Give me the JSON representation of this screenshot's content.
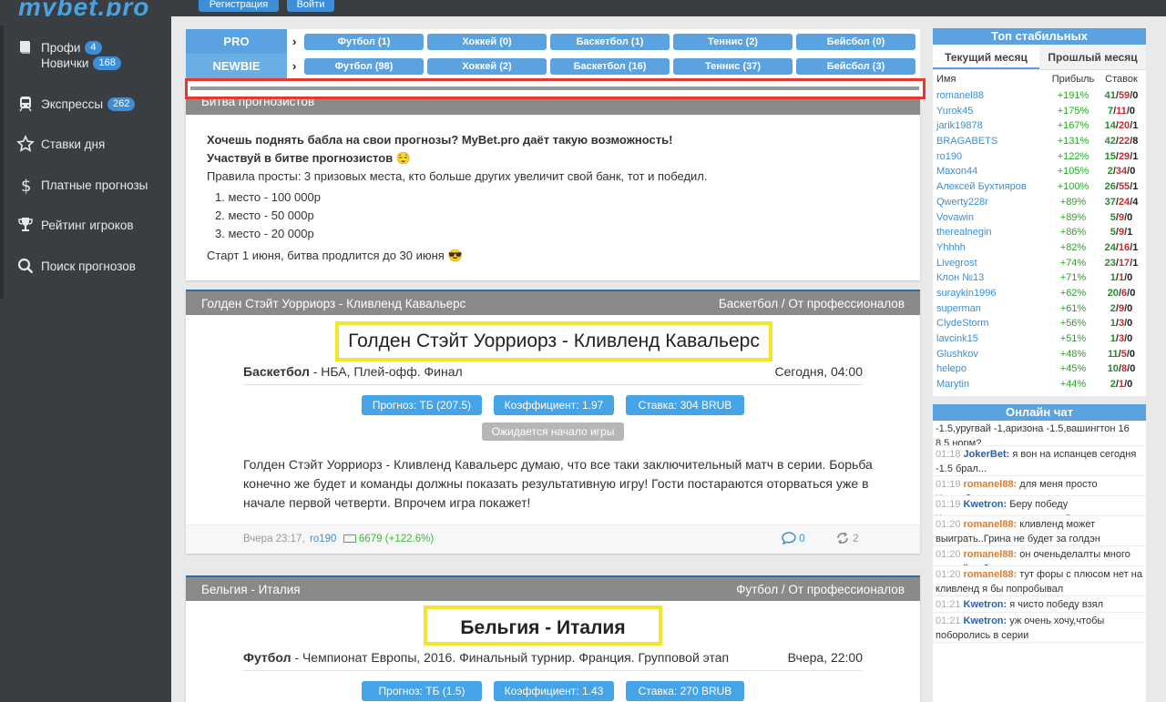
{
  "header": {
    "logo": "mybet.pro",
    "register_label": "Регистрация",
    "login_label": "Войти"
  },
  "sidebar": {
    "profi": {
      "label": "Профи",
      "count": "4"
    },
    "novice": {
      "label": "Новички",
      "count": "168"
    },
    "express": {
      "label": "Экспрессы",
      "count": "262"
    },
    "bets_day": "Ставки дня",
    "paid": "Платные прогнозы",
    "rating": "Рейтинг игроков",
    "search": "Поиск прогнозов"
  },
  "categories": {
    "pro": {
      "label": "PRO",
      "items": [
        "Футбол (1)",
        "Хоккей (0)",
        "Баскетбол (1)",
        "Теннис (2)",
        "Бейсбол (0)"
      ]
    },
    "newbie": {
      "label": "NEWBIE",
      "items": [
        "Футбол (98)",
        "Хоккей (2)",
        "Баскетбол (16)",
        "Теннис (37)",
        "Бейсбол (3)"
      ]
    }
  },
  "battle": {
    "title": "Битва прогнозистов",
    "line1": "Хочешь поднять бабла на свои прогнозы? MyBet.pro даёт такую возможность!",
    "line2": "Участвуй в битве прогнозистов 😌",
    "line3": "Правила просты: 3 призовых места, кто больше других увеличит свой банк, тот и победил.",
    "prizes": [
      "1. место - 100 000р",
      "2. место - 50 000р",
      "3. место - 20 000р"
    ],
    "footer": "Старт 1 июня, битва продлится до 30 июня 😎"
  },
  "prediction1": {
    "header_title": "Голден Стэйт Уорриорз - Кливленд Кавальерс",
    "header_sport": "Баскетбол",
    "header_type": "От профессионалов",
    "match_title": "Голден Стэйт Уорриорз - Кливленд Кавальерс",
    "sport": "Баскетбол",
    "league": " - НБА, Плей-офф. Финал",
    "datetime": "Сегодня, 04:00",
    "prognoz": "Прогноз: ТБ (207.5)",
    "coef": "Коэффициент: 1.97",
    "stake": "Ставка: 304 BRUB",
    "status": "Ожидается начало игры",
    "text": "Голден Стэйт Уорриорз - Кливленд Кавальерс думаю, что все таки заключительный матч в серии. Борьба конечно же будет и команды должны показать результативную игру! Гости постараются оторваться уже в начале первой четверти. Впрочем игра покажет!",
    "posted": "Вчера 23:17,",
    "author": "ro190",
    "bank": "6679 (+122.6%)",
    "comments": "0",
    "shares": "2"
  },
  "prediction2": {
    "header_title": "Бельгия - Италия",
    "header_sport": "Футбол",
    "header_type": "От профессионалов",
    "match_title": "Бельгия - Италия",
    "sport": "Футбол",
    "league": " - Чемпионат Европы, 2016. Финальный турнир. Франция. Групповой этап",
    "datetime": "Вчера, 22:00",
    "prognoz": "Прогноз: ТБ (1.5)",
    "coef": "Коэффициент: 1.43",
    "stake": "Ставка: 270 BRUB"
  },
  "top": {
    "title": "Топ стабильных",
    "tab_current": "Текущий месяц",
    "tab_prev": "Прошлый месяц",
    "col_name": "Имя",
    "col_profit": "Прибыль",
    "col_bets": "Ставок",
    "rows": [
      {
        "name": "romanel88",
        "profit": "+191%",
        "w": "41",
        "l": "59",
        "d": "0"
      },
      {
        "name": "Yurok45",
        "profit": "+175%",
        "w": "7",
        "l": "11",
        "d": "0"
      },
      {
        "name": "jarik19878",
        "profit": "+167%",
        "w": "14",
        "l": "20",
        "d": "1"
      },
      {
        "name": "BRAGABETS",
        "profit": "+131%",
        "w": "42",
        "l": "22",
        "d": "8"
      },
      {
        "name": "ro190",
        "profit": "+122%",
        "w": "15",
        "l": "29",
        "d": "1"
      },
      {
        "name": "Maxon44",
        "profit": "+105%",
        "w": "2",
        "l": "34",
        "d": "0"
      },
      {
        "name": "Алексей Бухтияров",
        "profit": "+100%",
        "w": "26",
        "l": "55",
        "d": "1"
      },
      {
        "name": "Qwerty228r",
        "profit": "+89%",
        "w": "37",
        "l": "24",
        "d": "4"
      },
      {
        "name": "Vovawin",
        "profit": "+89%",
        "w": "5",
        "l": "9",
        "d": "0"
      },
      {
        "name": "therealnegin",
        "profit": "+86%",
        "w": "5",
        "l": "9",
        "d": "1"
      },
      {
        "name": "Yhhhh",
        "profit": "+82%",
        "w": "24",
        "l": "16",
        "d": "1"
      },
      {
        "name": "Livegrost",
        "profit": "+74%",
        "w": "23",
        "l": "17",
        "d": "1"
      },
      {
        "name": "Клон №13",
        "profit": "+71%",
        "w": "1",
        "l": "1",
        "d": "0"
      },
      {
        "name": "suraykin1996",
        "profit": "+62%",
        "w": "20",
        "l": "6",
        "d": "0"
      },
      {
        "name": "superman",
        "profit": "+61%",
        "w": "2",
        "l": "9",
        "d": "0"
      },
      {
        "name": "ClydeStorm",
        "profit": "+56%",
        "w": "1",
        "l": "3",
        "d": "0"
      },
      {
        "name": "lavcink15",
        "profit": "+51%",
        "w": "1",
        "l": "3",
        "d": "0"
      },
      {
        "name": "Glushkov",
        "profit": "+48%",
        "w": "11",
        "l": "5",
        "d": "0"
      },
      {
        "name": "helepo",
        "profit": "+45%",
        "w": "10",
        "l": "8",
        "d": "0"
      },
      {
        "name": "Marytin",
        "profit": "+44%",
        "w": "2",
        "l": "1",
        "d": "0"
      }
    ]
  },
  "chat": {
    "title": "Онлайн чат",
    "first_text": "-1.5,уругвай -1,аризона -1.5,вашингтон 16 8.5 норм?",
    "messages": [
      {
        "time": "01:18",
        "user": "JokerBet:",
        "text": "я вон на испанцев сегодня -1.5 брал...",
        "cls": "u2"
      },
      {
        "time": "01:19",
        "user": "romanel88:",
        "text": "для меня просто Исланбия не команда...да опыта ноль у них",
        "cls": "u1"
      },
      {
        "time": "01:19",
        "user": "Kwetron:",
        "text": "Беру победу Кливленда,верю в команду:D",
        "cls": "u2"
      },
      {
        "time": "01:20",
        "user": "romanel88:",
        "text": "кливленд может выиграть..Грина не будет за голдэн",
        "cls": "u1"
      },
      {
        "time": "01:20",
        "user": "romanel88:",
        "text": "он оченьделалты много черной рабо",
        "cls": "u1"
      },
      {
        "time": "01:20",
        "user": "romanel88:",
        "text": "тут форы с плюсом нет на кливленд я бы попробывал",
        "cls": "u1"
      },
      {
        "time": "01:21",
        "user": "Kwetron:",
        "text": "я чисто победу взял",
        "cls": "u2"
      },
      {
        "time": "01:21",
        "user": "Kwetron:",
        "text": "уж очень хочу,чтобы поборолись в серии",
        "cls": "u2"
      }
    ]
  }
}
